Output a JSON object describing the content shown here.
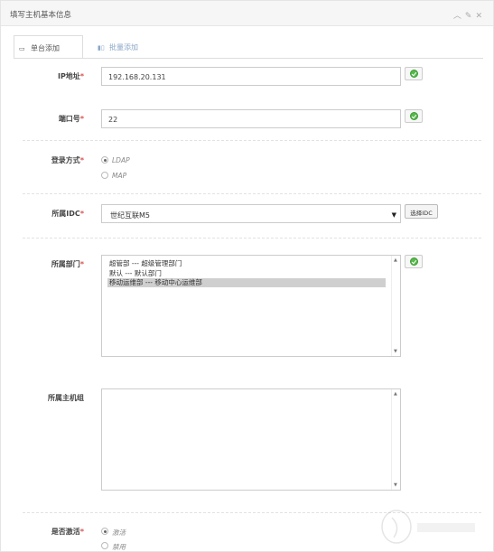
{
  "panel": {
    "title": "填写主机基本信息",
    "icons": [
      "chevron-up-icon",
      "wrench-icon",
      "close-icon"
    ]
  },
  "tabs": [
    {
      "label": "单台添加",
      "icon": "window-icon",
      "active": true
    },
    {
      "label": "批量添加",
      "icon": "bar-chart-icon",
      "active": false
    }
  ],
  "form": {
    "ip": {
      "label": "IP地址",
      "required": "*",
      "value": "192.168.20.131"
    },
    "port": {
      "label": "端口号",
      "required": "*",
      "value": "22"
    },
    "login": {
      "label": "登录方式",
      "required": "*",
      "options": [
        "LDAP",
        "MAP"
      ],
      "selected": "LDAP"
    },
    "idc": {
      "label": "所属IDC",
      "required": "*",
      "value": "世纪互联M5",
      "button": "选择IDC"
    },
    "dept": {
      "label": "所属部门",
      "required": "*",
      "options": [
        "超管部 --- 超级管理部门",
        "默认 --- 默认部门",
        "移动运维部 --- 移动中心运维部"
      ],
      "selected": "移动运维部 --- 移动中心运维部"
    },
    "hostgroup": {
      "label": "所属主机组",
      "options": []
    },
    "active": {
      "label": "是否激活",
      "required": "*",
      "options": [
        "激活",
        "禁用"
      ],
      "selected": "激活"
    }
  },
  "colors": {
    "ok_green": "#58b94a",
    "required_red": "#d9534f",
    "tab_link": "#8aa7c7"
  }
}
